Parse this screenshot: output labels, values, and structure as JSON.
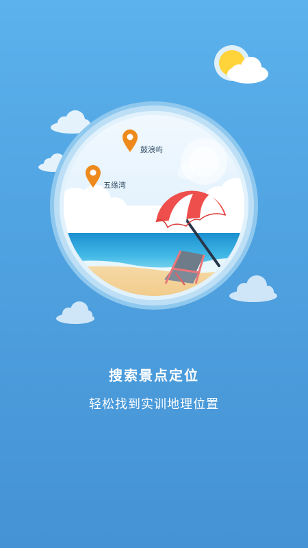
{
  "onboarding": {
    "title": "搜索景点定位",
    "subtitle": "轻松找到实训地理位置"
  },
  "map_pins": [
    {
      "label": "鼓浪屿",
      "icon": "location-pin-icon"
    },
    {
      "label": "五缘湾",
      "icon": "location-pin-icon"
    }
  ],
  "colors": {
    "background_top": "#5bb2ec",
    "background_bottom": "#4592d4",
    "pin": "#ee8a1c",
    "umbrella_red": "#ee4f4c",
    "sun": "#ffd33a"
  },
  "icons": [
    "sun-icon",
    "cloud-icon",
    "beach-umbrella-icon",
    "deck-chair-icon",
    "location-pin-icon"
  ]
}
